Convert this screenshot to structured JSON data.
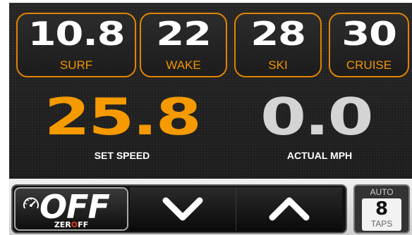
{
  "presets": [
    {
      "value": "10.8",
      "label": "SURF"
    },
    {
      "value": "22",
      "label": "WAKE"
    },
    {
      "value": "28",
      "label": "SKI"
    },
    {
      "value": "30",
      "label": "CRUISE"
    }
  ],
  "set_speed": {
    "value": "25.8",
    "label": "SET SPEED"
  },
  "actual_speed": {
    "value": "0.0",
    "label": "ACTUAL MPH"
  },
  "zero_off": {
    "state": "OFF",
    "brand_left": "ZER",
    "brand_o": "O",
    "brand_right": "FF"
  },
  "auto_taps": {
    "mode": "AUTO",
    "count": "8",
    "unit": "TAPS"
  },
  "icons": {
    "gauge": "gauge-icon",
    "down": "chevron-down-icon",
    "up": "chevron-up-icon"
  },
  "colors": {
    "accent": "#f29400",
    "background": "#1f1f1f",
    "actual_value": "#d4d4d4"
  }
}
